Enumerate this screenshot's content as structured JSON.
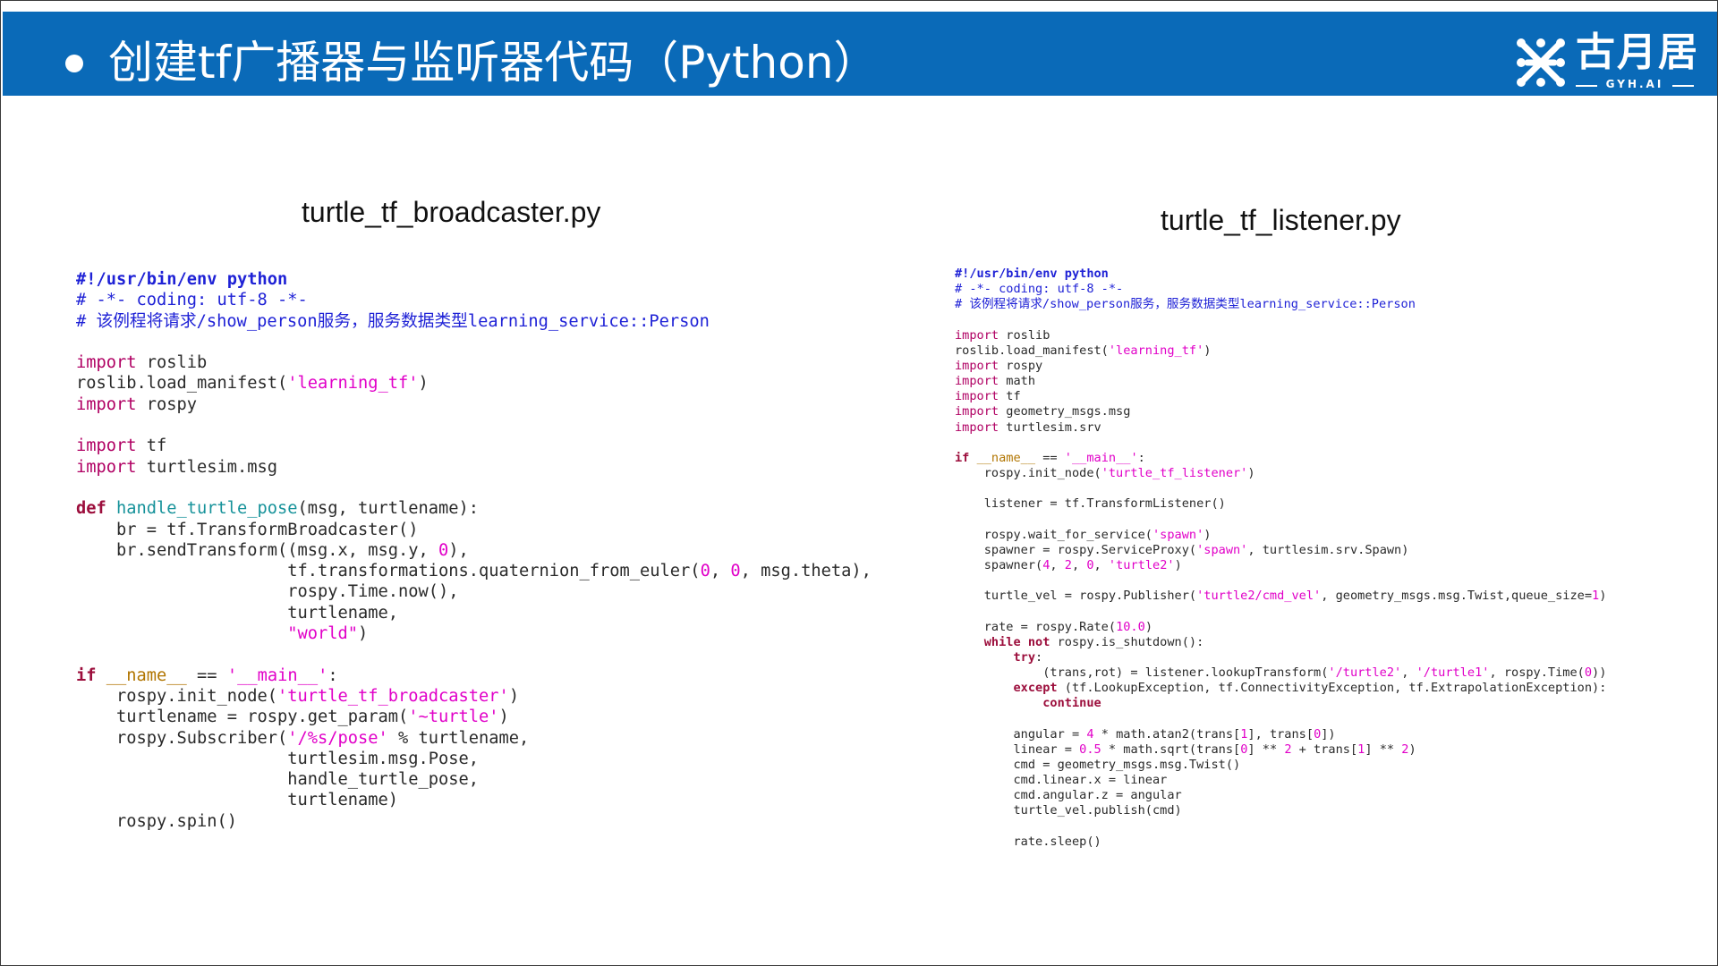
{
  "header": {
    "title": "创建tf广播器与监听器代码（Python）",
    "logo_text": "古月居",
    "logo_sub": "GYH.AI",
    "bg_color": "#0a6ab8"
  },
  "left": {
    "filename": "turtle_tf_broadcaster.py"
  },
  "right": {
    "filename": "turtle_tf_listener.py"
  },
  "code_style": {
    "keyword_color": "#b00063",
    "string_color": "#e100c8",
    "comment_color": "#1f22d6",
    "function_color": "#16929a"
  }
}
